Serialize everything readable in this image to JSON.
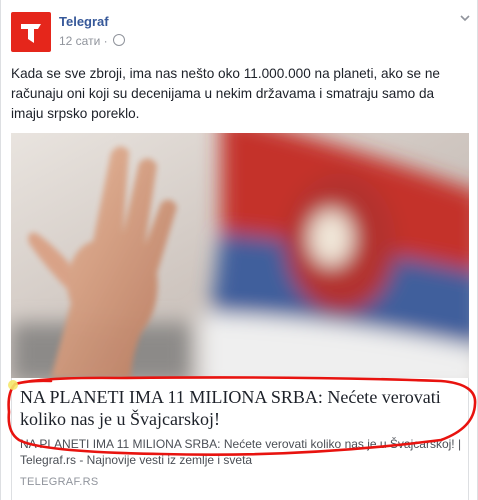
{
  "post": {
    "page_name": "Telegraf",
    "timestamp": "12 сати",
    "separator": "·",
    "text": "Kada se sve zbroji, ima nas nešto oko 11.000.000 na planeti, ako se ne računaju oni koji su decenijama u nekim državama i smatraju samo da imaju srpsko poreklo.",
    "icons": [
      "telegraf-logo",
      "globe-icon",
      "chevron-down-icon"
    ]
  },
  "link": {
    "title": "NA PLANETI IMA 11 MILIONA SRBA: Nećete verovati koliko nas je u Švajcarskoj!",
    "description": "NA PLANETI IMA 11 MILIONA SRBA: Nećete verovati koliko nas je u Švajcarskoj! | Telegraf.rs - Najnovije vesti iz zemlje i sveta",
    "domain": "TELEGRAF.RS"
  },
  "colors": {
    "brand_red": "#e5261b",
    "link_blue": "#365899",
    "marker_red": "#e8130f",
    "flag_red": "#c4302b",
    "flag_blue": "#3f5f9c"
  }
}
